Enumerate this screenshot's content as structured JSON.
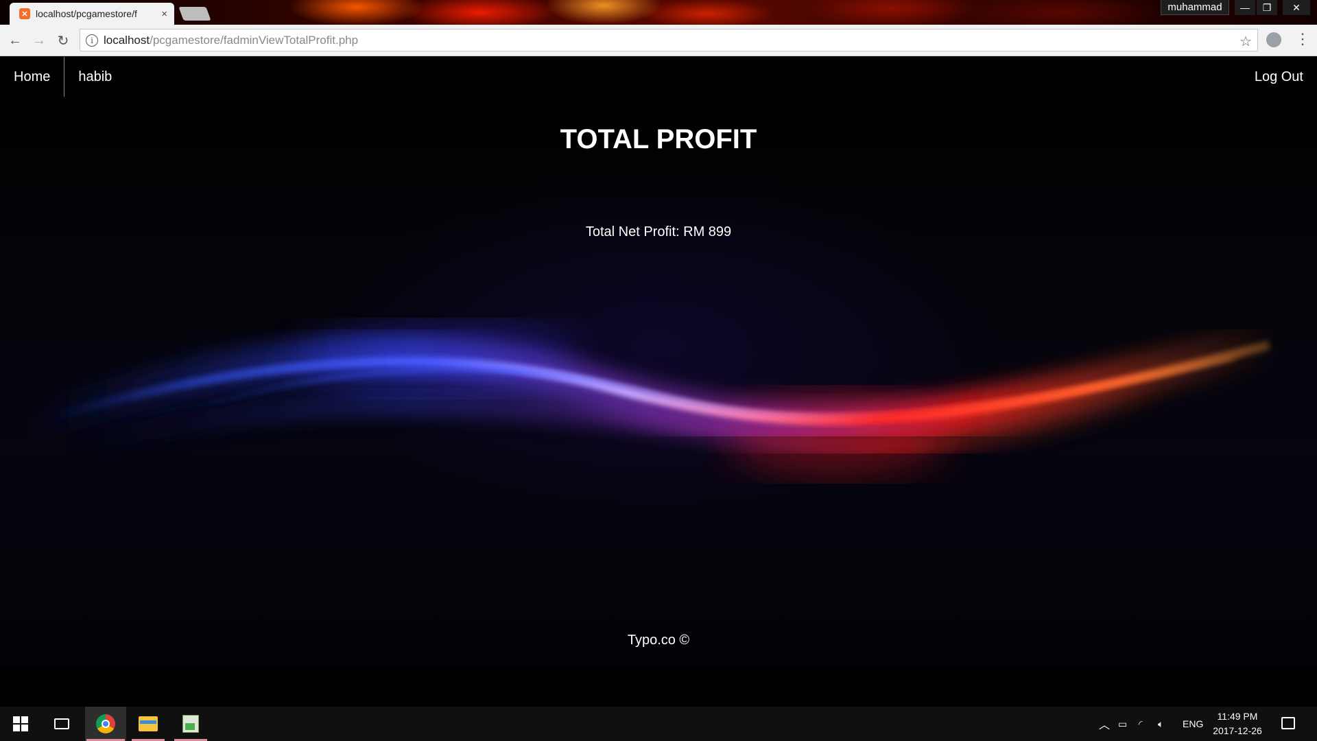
{
  "browser": {
    "tab_title": "localhost/pcgamestore/f",
    "tab_close": "×",
    "user_name": "muhammad",
    "url_host": "localhost",
    "url_path": "/pcgamestore/fadminViewTotalProfit.php"
  },
  "nav": {
    "home": "Home",
    "user": "habib",
    "logout": "Log Out"
  },
  "main": {
    "title": "TOTAL PROFIT",
    "profit_text": "Total Net Profit: RM 899"
  },
  "footer": {
    "text": "Typo.co ©"
  },
  "taskbar": {
    "language": "ENG",
    "time": "11:49 PM",
    "date": "2017-12-26"
  },
  "colors": {
    "accent_red": "#ff2a1a",
    "accent_blue": "#3a4dff",
    "accent_orange": "#ff8a2a"
  }
}
